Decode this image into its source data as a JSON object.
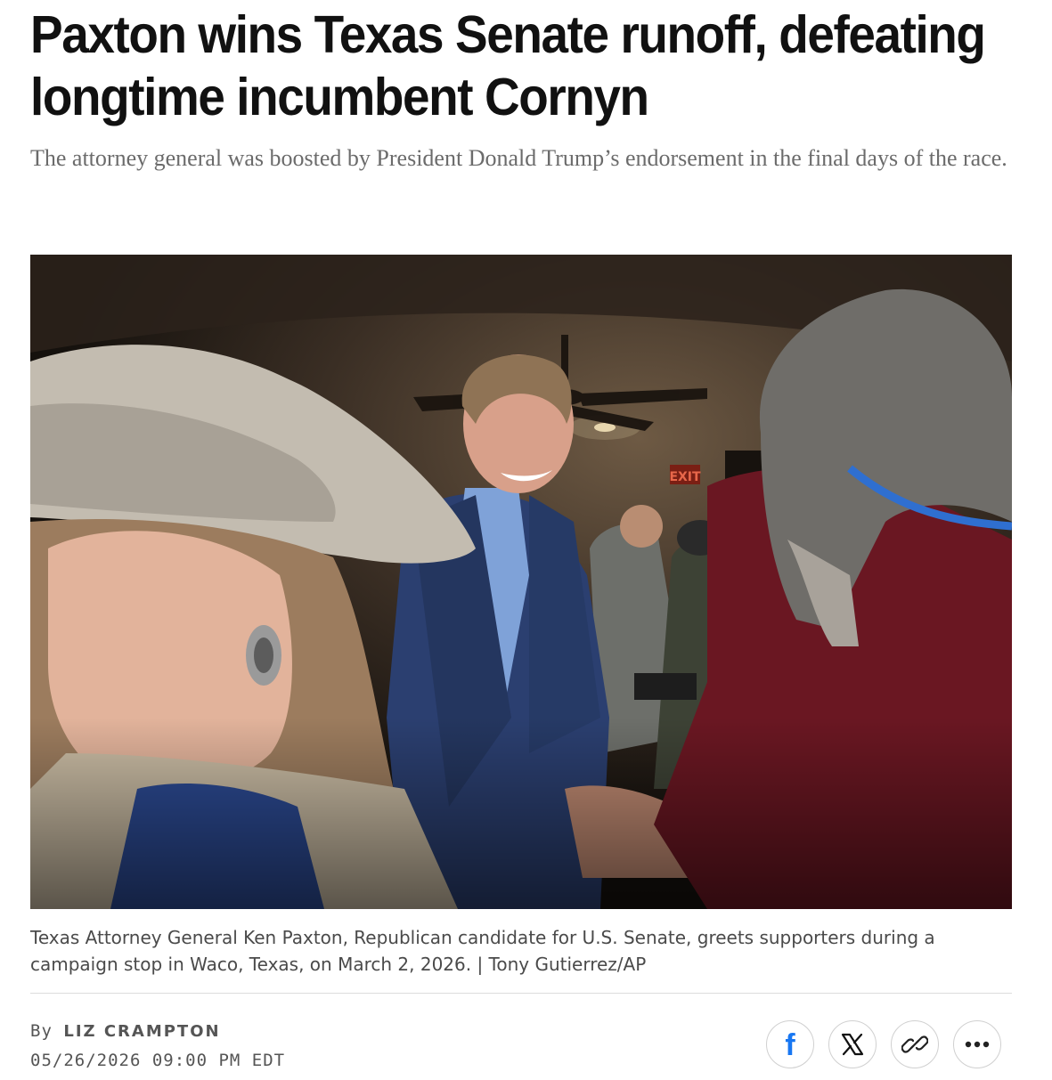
{
  "article": {
    "headline": "Paxton wins Texas Senate runoff, defeating longtime incumbent Cornyn",
    "dek": "The attorney general was boosted by President Donald Trump’s endorsement in the final days of the race.",
    "photo": {
      "exit_sign": "EXIT",
      "caption": "Texas Attorney General Ken Paxton, Republican candidate for U.S. Senate, greets supporters during a campaign stop in Waco, Texas, on March 2, 2026. | Tony Gutierrez/AP"
    },
    "byline": {
      "prefix": "By",
      "author": "LIZ CRAMPTON",
      "timestamp": "05/26/2026 09:00 PM EDT"
    }
  },
  "share": {
    "facebook_glyph": "f",
    "buttons": [
      {
        "icon": "facebook-icon"
      },
      {
        "icon": "x-icon"
      },
      {
        "icon": "link-icon"
      },
      {
        "icon": "more-icon"
      }
    ]
  },
  "colors": {
    "headline": "#111111",
    "dek": "#6b6b6b",
    "caption": "#4a4a4a",
    "facebook": "#1877f2"
  }
}
